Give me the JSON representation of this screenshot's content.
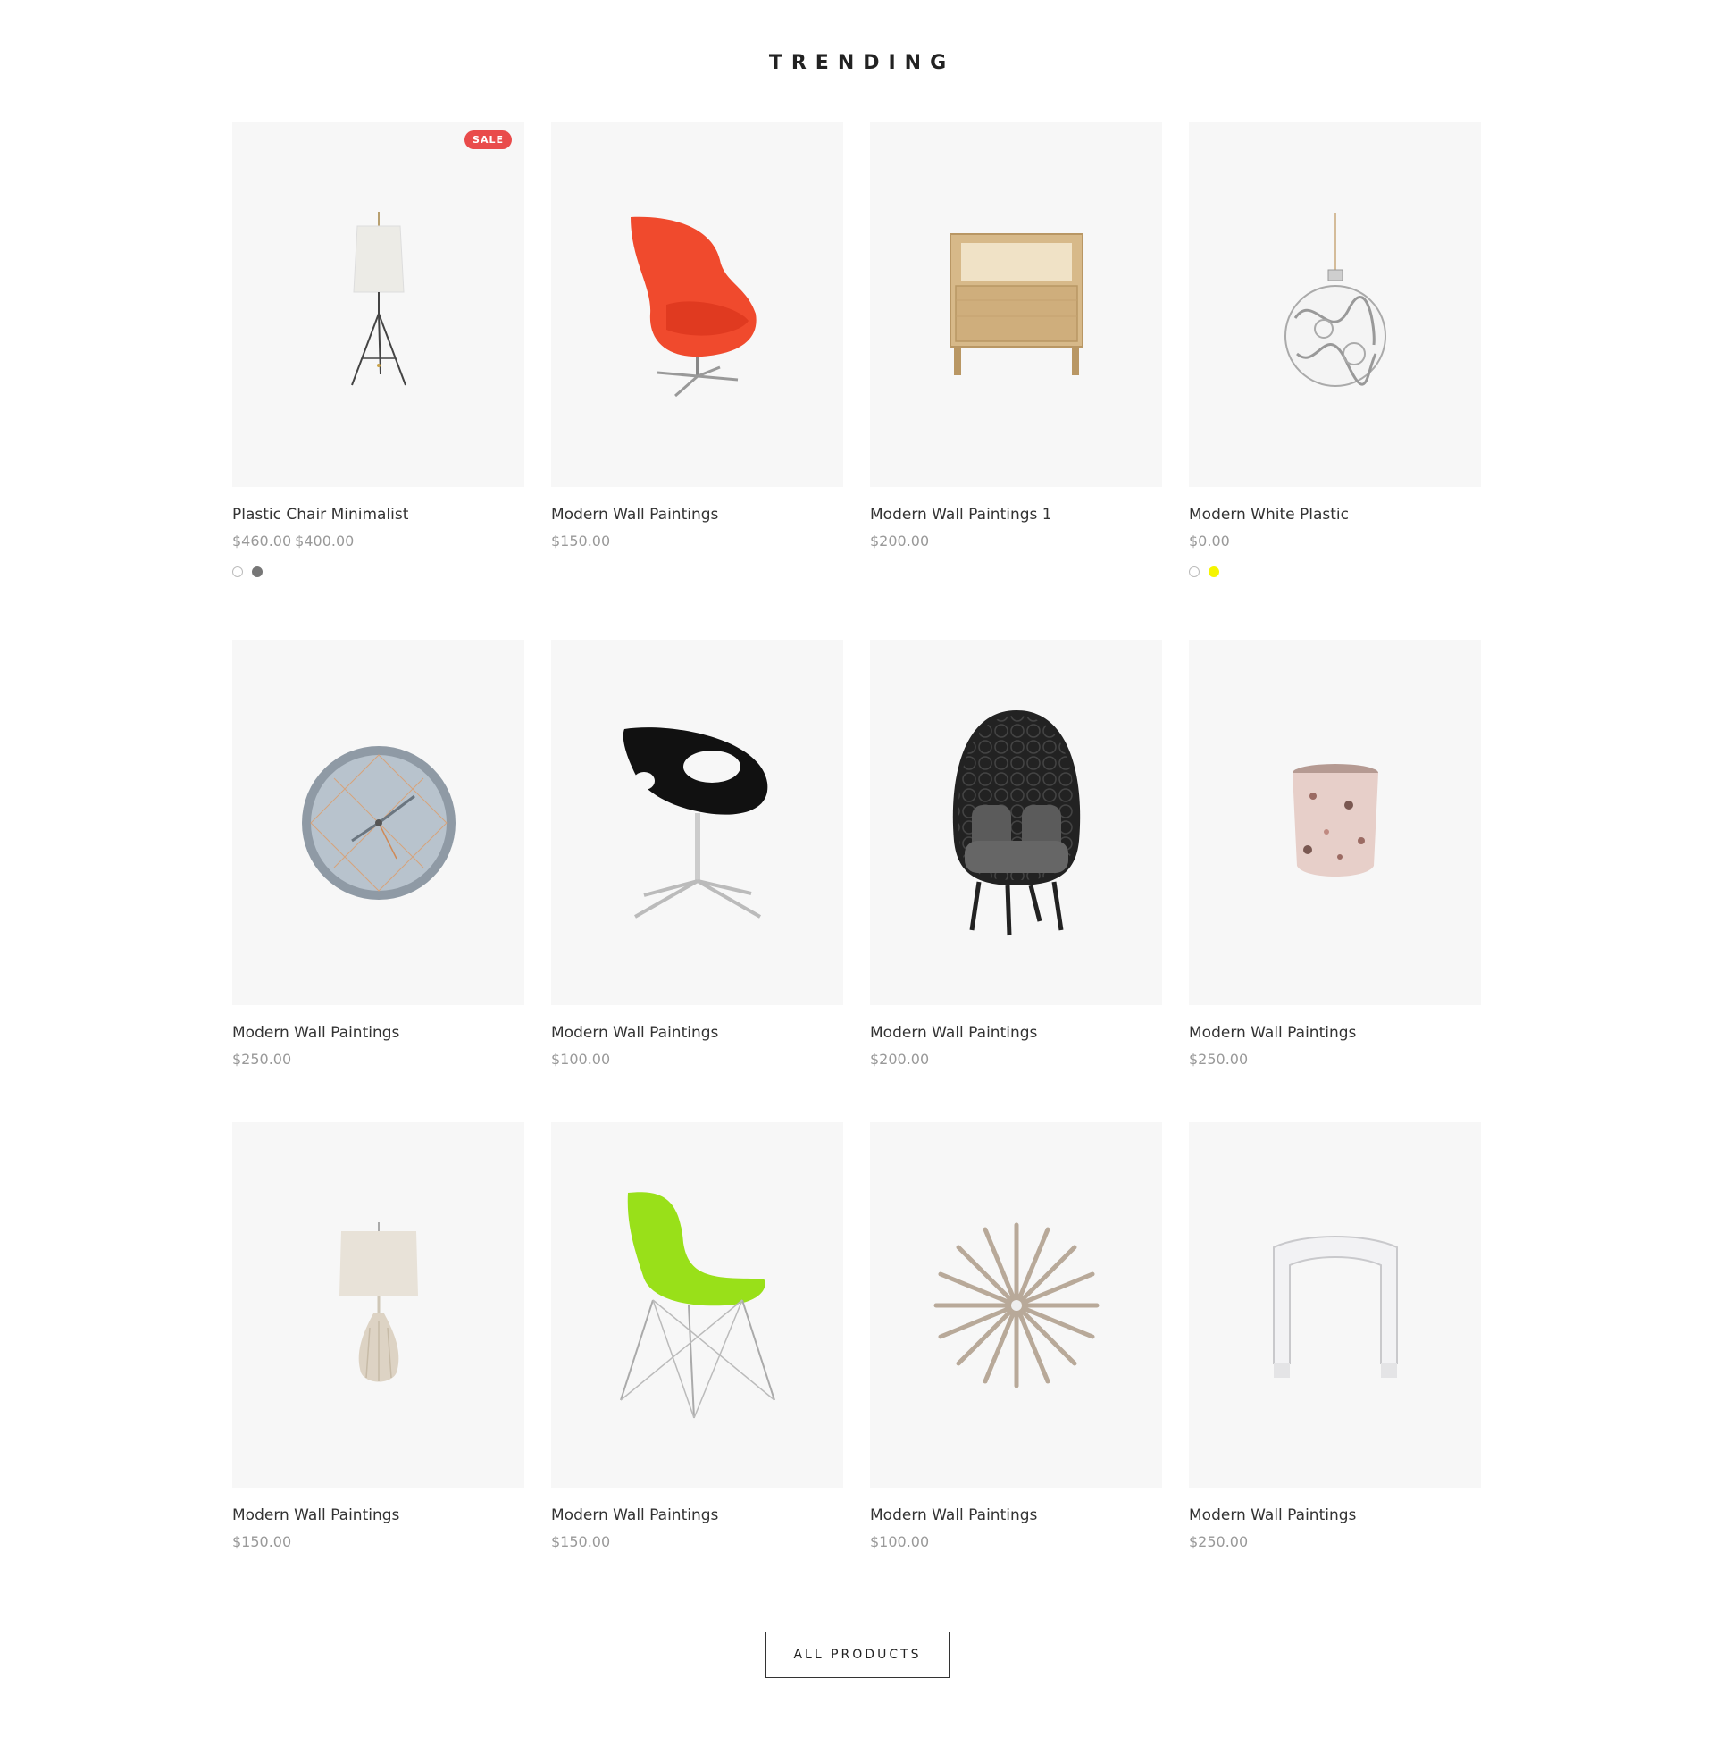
{
  "section_title": "TRENDING",
  "sale_badge": "SALE",
  "all_products_label": "ALL PRODUCTS",
  "colors": {
    "sale": "#e94b4b",
    "swatch_white": "#ffffff",
    "swatch_grey": "#777777",
    "swatch_yellow": "#f5f500"
  },
  "products": [
    {
      "title": "Plastic Chair Minimalist",
      "old_price": "$460.00",
      "price": "$400.00",
      "image": "tripod-table-lamp",
      "sale": true,
      "swatches": [
        "#ffffff",
        "#777777"
      ]
    },
    {
      "title": "Modern Wall Paintings",
      "price": "$150.00",
      "image": "red-egg-chair"
    },
    {
      "title": "Modern Wall Paintings 1",
      "price": "$200.00",
      "image": "wooden-nightstand"
    },
    {
      "title": "Modern White Plastic",
      "price": "$0.00",
      "image": "glass-ornament",
      "swatches": [
        "#ffffff",
        "#f5f500"
      ]
    },
    {
      "title": "Modern Wall Paintings",
      "price": "$250.00",
      "image": "wall-clock"
    },
    {
      "title": "Modern Wall Paintings",
      "price": "$100.00",
      "image": "black-swivel-chair"
    },
    {
      "title": "Modern Wall Paintings",
      "price": "$200.00",
      "image": "wicker-egg-chair"
    },
    {
      "title": "Modern Wall Paintings",
      "price": "$250.00",
      "image": "terrazzo-candle"
    },
    {
      "title": "Modern Wall Paintings",
      "price": "$150.00",
      "image": "ceramic-table-lamp"
    },
    {
      "title": "Modern Wall Paintings",
      "price": "$150.00",
      "image": "green-eiffel-chair"
    },
    {
      "title": "Modern Wall Paintings",
      "price": "$100.00",
      "image": "starburst-clock"
    },
    {
      "title": "Modern Wall Paintings",
      "price": "$250.00",
      "image": "white-acrylic-stool"
    }
  ]
}
